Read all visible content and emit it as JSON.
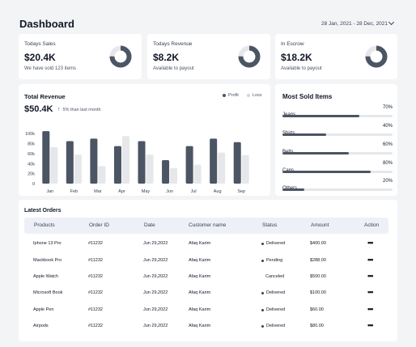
{
  "header": {
    "title": "Dashboard",
    "date_range": "28 Jan, 2021 - 28 Dec, 2021"
  },
  "stats": [
    {
      "label": "Todays Sales",
      "value": "$20.4K",
      "sub": "We have sold 123 items",
      "donut_fraction": 0.75
    },
    {
      "label": "Todays Revenue",
      "value": "$8.2K",
      "sub": "Available to payout",
      "donut_fraction": 0.75
    },
    {
      "label": "In Escrow",
      "value": "$18.2K",
      "sub": "Available to payout",
      "donut_fraction": 0.75
    }
  ],
  "revenue": {
    "title": "Total Revenue",
    "value": "$50.4K",
    "change": "5% than last month",
    "colors": {
      "profit": "#4b5563",
      "loss": "#e5e7eb"
    }
  },
  "chart_data": {
    "type": "bar",
    "categories": [
      "Jan",
      "Feb",
      "Mar",
      "Apr",
      "May",
      "Jun",
      "Jul",
      "Aug",
      "Sep"
    ],
    "series": [
      {
        "name": "Profit",
        "values": [
          105,
          85,
          90,
          75,
          85,
          47,
          75,
          90,
          83
        ]
      },
      {
        "name": "Loss",
        "values": [
          73,
          58,
          35,
          95,
          58,
          31,
          38,
          62,
          57
        ]
      }
    ],
    "yticks": [
      "100k",
      "80k",
      "60k",
      "40k",
      "20k",
      "0"
    ],
    "ylim": [
      0,
      110
    ],
    "legend": "top-right"
  },
  "most_sold": {
    "title": "Most Sold Items",
    "items": [
      {
        "label": "Jeans",
        "pct": "70%",
        "value": 70
      },
      {
        "label": "Shirts",
        "pct": "40%",
        "value": 40
      },
      {
        "label": "Belts",
        "pct": "60%",
        "value": 60
      },
      {
        "label": "Caps",
        "pct": "80%",
        "value": 80
      },
      {
        "label": "Others",
        "pct": "20%",
        "value": 20
      }
    ]
  },
  "orders": {
    "title": "Latest Orders",
    "columns": [
      "Products",
      "Order ID",
      "Date",
      "Customer name",
      "Status",
      "Amount",
      "Action"
    ],
    "rows": [
      {
        "product": "Iphone 13 Pro",
        "id": "#11232",
        "date": "Jun 29,2022",
        "customer": "Afaq Karim",
        "status": "Delivered",
        "dot": true,
        "amount": "$400.00",
        "action": "•••"
      },
      {
        "product": "Mackbook Pro",
        "id": "#11232",
        "date": "Jun 29,2022",
        "customer": "Afaq Karim",
        "status": "Pending",
        "dot": true,
        "amount": "$288.00",
        "action": "•••"
      },
      {
        "product": "Apple Watch",
        "id": "#11232",
        "date": "Jun 29,2022",
        "customer": "Afaq Karim",
        "status": "Canceled",
        "dot": false,
        "amount": "$500.00",
        "action": "•••"
      },
      {
        "product": "Microsoft Book",
        "id": "#11232",
        "date": "Jun 29,2022",
        "customer": "Afaq Karim",
        "status": "Delivered",
        "dot": true,
        "amount": "$100.00",
        "action": "•••"
      },
      {
        "product": "Apple Pen",
        "id": "#11232",
        "date": "Jun 29,2022",
        "customer": "Afaq Karim",
        "status": "Delivered",
        "dot": true,
        "amount": "$60.00",
        "action": "•••"
      },
      {
        "product": "Airpods",
        "id": "#11232",
        "date": "Jun 29,2022",
        "customer": "Afaq Karim",
        "status": "Delivered",
        "dot": true,
        "amount": "$80.00",
        "action": "•••"
      }
    ]
  }
}
